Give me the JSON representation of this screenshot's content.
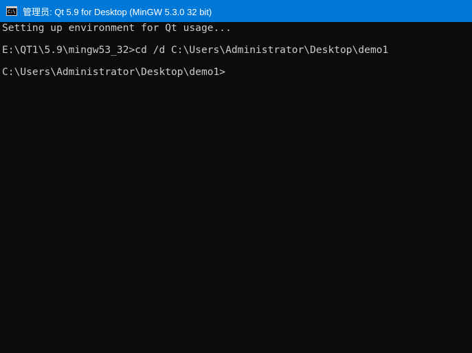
{
  "window": {
    "title": "管理员: Qt 5.9 for Desktop (MinGW 5.3.0 32 bit)",
    "icon_name": "command-prompt-icon",
    "icon_glyph": "C:\\",
    "titlebar_color": "#0078d7",
    "background_color": "#0c0c0c",
    "text_color": "#cccccc"
  },
  "console": {
    "lines": [
      "Setting up environment for Qt usage...",
      "",
      "E:\\QT1\\5.9\\mingw53_32>cd /d C:\\Users\\Administrator\\Desktop\\demo1",
      "",
      "C:\\Users\\Administrator\\Desktop\\demo1>"
    ]
  }
}
